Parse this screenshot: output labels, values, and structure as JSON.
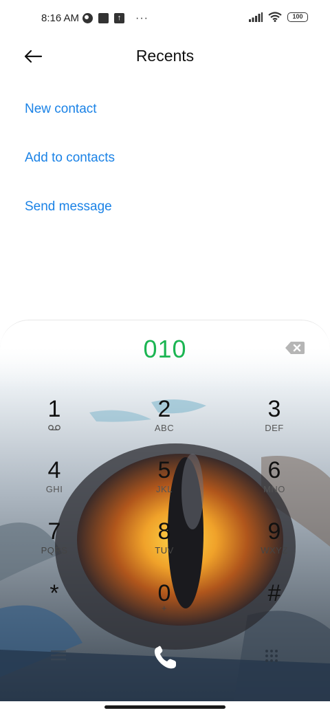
{
  "status_bar": {
    "time": "8:16 AM",
    "left_icons": [
      "vpn-circle-icon",
      "square-notification-icon",
      "upload-notification-icon"
    ],
    "more": "···",
    "right_icons": [
      "signal-icon",
      "wifi-icon"
    ],
    "battery": "100"
  },
  "header": {
    "back_icon": "arrow-left-icon",
    "title": "Recents"
  },
  "actions": {
    "new_contact": "New contact",
    "add_to_contacts": "Add to contacts",
    "send_message": "Send message"
  },
  "dialer": {
    "number": "010",
    "backspace_icon": "backspace-icon",
    "keys": [
      {
        "digit": "1",
        "letters": "",
        "icon": "voicemail-icon"
      },
      {
        "digit": "2",
        "letters": "ABC"
      },
      {
        "digit": "3",
        "letters": "DEF"
      },
      {
        "digit": "4",
        "letters": "GHI"
      },
      {
        "digit": "5",
        "letters": "JKL"
      },
      {
        "digit": "6",
        "letters": "MNO"
      },
      {
        "digit": "7",
        "letters": "PQRS"
      },
      {
        "digit": "8",
        "letters": "TUV"
      },
      {
        "digit": "9",
        "letters": "WXYZ"
      },
      {
        "digit": "*",
        "letters": ""
      },
      {
        "digit": "0",
        "letters": "+"
      },
      {
        "digit": "#",
        "letters": ""
      }
    ],
    "bottom_icons": [
      "menu-icon",
      "call-icon",
      "dialpad-icon"
    ],
    "accent_color": "#1bb552",
    "link_color": "#1a82e6"
  }
}
